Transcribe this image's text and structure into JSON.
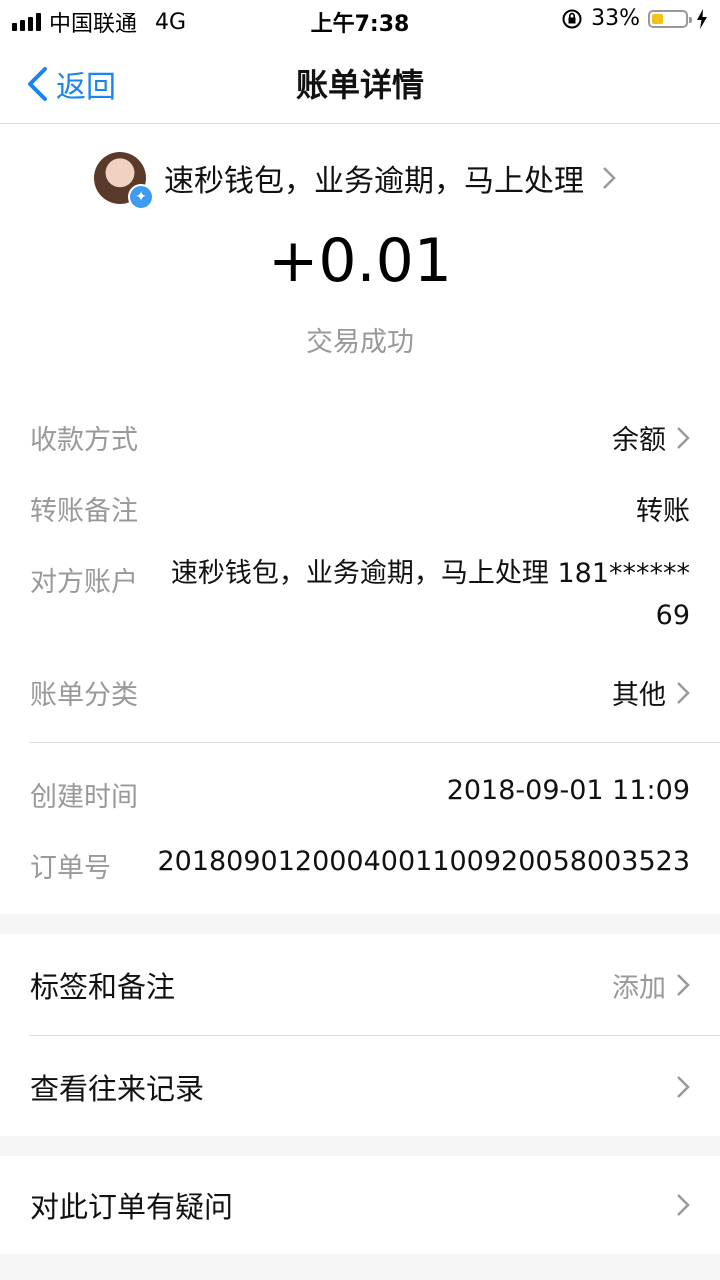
{
  "status_bar": {
    "carrier": "中国联通",
    "network": "4G",
    "time": "上午7:38",
    "battery": "33%",
    "battery_level": 0.33
  },
  "nav": {
    "back_label": "返回",
    "title": "账单详情"
  },
  "bill": {
    "payee": "速秒钱包，业务逾期，马上处理",
    "amount": "+0.01",
    "status": "交易成功",
    "rows": [
      {
        "label": "收款方式",
        "value": "余额"
      },
      {
        "label": "转账备注",
        "value": "转账"
      },
      {
        "label": "对方账户",
        "value_line1": "速秒钱包，业务逾期，马上处理 181******",
        "value_line2": "69"
      },
      {
        "label": "账单分类",
        "value": "其他"
      },
      {
        "label": "创建时间",
        "value": "2018-09-01 11:09"
      },
      {
        "label": "订单号",
        "value": "2018090120004001100920058003523"
      }
    ]
  },
  "actions": {
    "tags_label": "标签和备注",
    "tags_hint": "添加",
    "history_label": "查看往来记录",
    "question_label": "对此订单有疑问"
  }
}
